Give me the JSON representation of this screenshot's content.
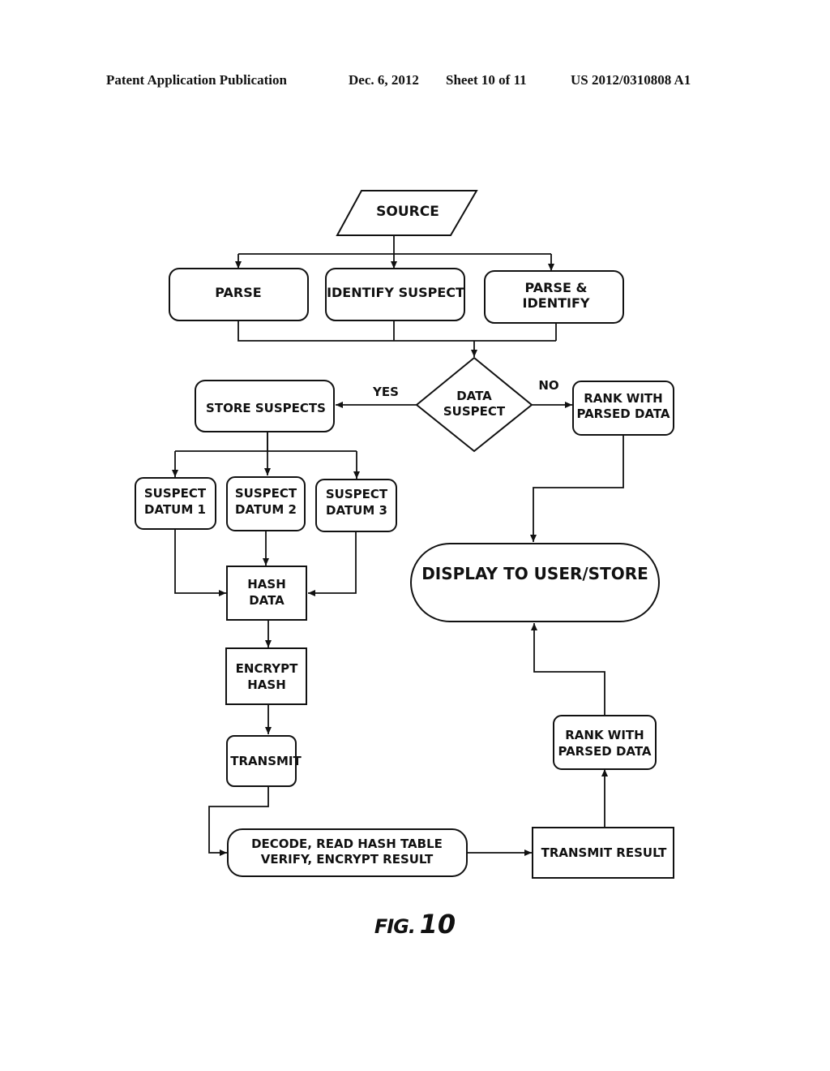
{
  "header": {
    "publication": "Patent Application Publication",
    "date": "Dec. 6, 2012",
    "sheet": "Sheet 10 of 11",
    "number": "US 2012/0310808 A1"
  },
  "nodes": {
    "source": [
      "SOURCE"
    ],
    "parse": [
      "PARSE"
    ],
    "identify_suspect": [
      "IDENTIFY SUSPECT"
    ],
    "parse_identify": [
      "PARSE &",
      "IDENTIFY"
    ],
    "data_suspect": [
      "DATA",
      "SUSPECT"
    ],
    "store_suspects": [
      "STORE SUSPECTS"
    ],
    "rank_with_parsed_data_1": [
      "RANK WITH",
      "PARSED DATA"
    ],
    "suspect_datum_1": [
      "SUSPECT",
      "DATUM 1"
    ],
    "suspect_datum_2": [
      "SUSPECT",
      "DATUM 2"
    ],
    "suspect_datum_3": [
      "SUSPECT",
      "DATUM 3"
    ],
    "hash_data": [
      "HASH",
      "DATA"
    ],
    "display": [
      "DISPLAY TO USER/STORE"
    ],
    "encrypt_hash": [
      "ENCRYPT",
      "HASH"
    ],
    "transmit": [
      "TRANSMIT"
    ],
    "rank_with_parsed_data_2": [
      "RANK WITH",
      "PARSED DATA"
    ],
    "decode": [
      "DECODE, READ HASH TABLE",
      "VERIFY, ENCRYPT RESULT"
    ],
    "transmit_result": [
      "TRANSMIT RESULT"
    ]
  },
  "edge_labels": {
    "yes": "YES",
    "no": "NO"
  },
  "figure": {
    "prefix": "FIG.",
    "number": "10"
  }
}
